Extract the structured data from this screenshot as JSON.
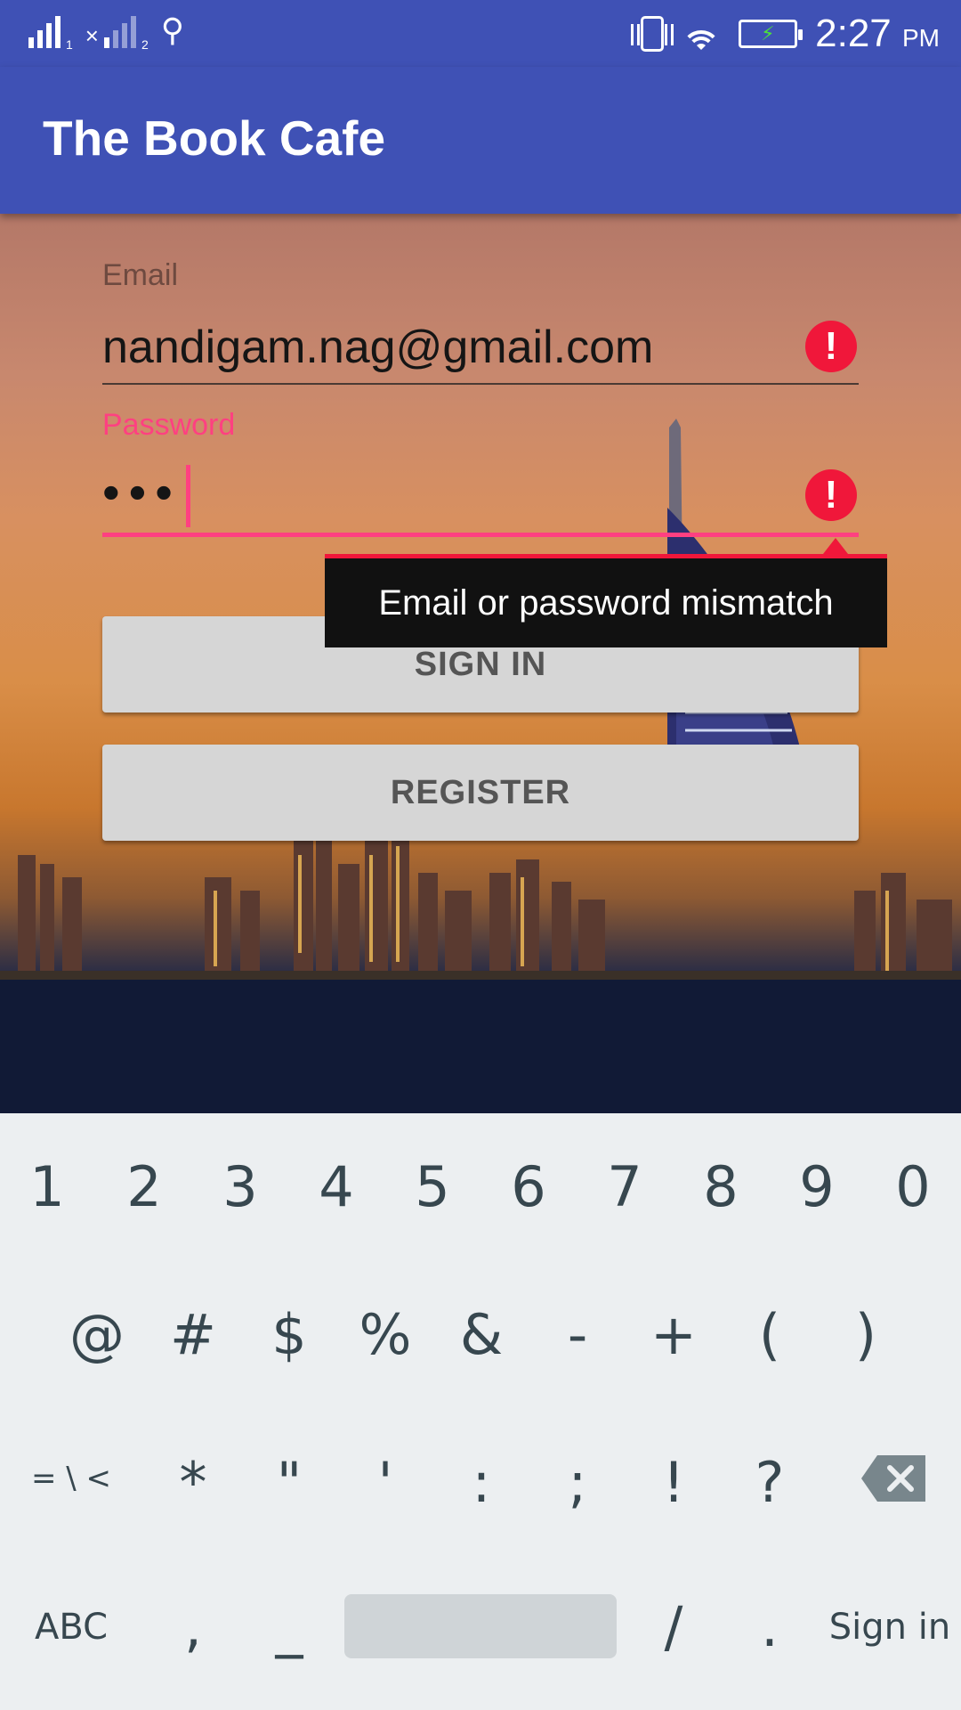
{
  "status_bar": {
    "sim1": "1",
    "sim2": "2",
    "time": "2:27",
    "ampm": "PM",
    "icons": [
      "signal-sim1-icon",
      "signal-sim2-icon",
      "usb-icon",
      "vibrate-icon",
      "wifi-icon",
      "battery-charging-icon"
    ]
  },
  "app_bar": {
    "title": "The Book Cafe"
  },
  "form": {
    "email_label": "Email",
    "email_value": "nandigam.nag@gmail.com",
    "password_label": "Password",
    "password_value": "•••",
    "error_icon": "!",
    "error_message": "Email or password mismatch"
  },
  "buttons": {
    "sign_in": "SIGN IN",
    "register": "REGISTER"
  },
  "keyboard": {
    "row1": [
      "1",
      "2",
      "3",
      "4",
      "5",
      "6",
      "7",
      "8",
      "9",
      "0"
    ],
    "row2": [
      "@",
      "#",
      "$",
      "%",
      "&",
      "-",
      "+",
      "(",
      ")"
    ],
    "row3": [
      "= \\ <",
      "*",
      "\"",
      "'",
      ":",
      ";",
      "!",
      "?"
    ],
    "row4": [
      "ABC",
      ",",
      "_",
      "/",
      ".",
      "Sign in"
    ]
  },
  "colors": {
    "primary": "#3F51B5",
    "accent": "#FF4081",
    "error": "#F0173A",
    "keyboard_bg": "#ECEFF1",
    "button_bg": "#D6D6D6"
  }
}
